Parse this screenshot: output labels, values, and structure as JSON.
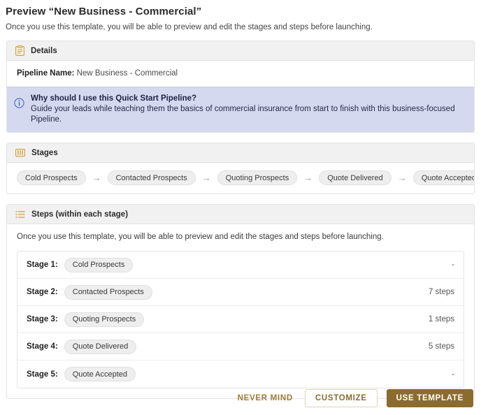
{
  "header": {
    "title": "Preview “New Business - Commercial”",
    "subtitle": "Once you use this template, you will be able to preview and edit the stages and steps before launching."
  },
  "details": {
    "section_title": "Details",
    "section_icon": "clipboard-icon",
    "pipeline_name_label": "Pipeline Name:",
    "pipeline_name_value": "New Business - Commercial",
    "callout": {
      "icon": "info-circle-icon",
      "title": "Why should I use this Quick Start Pipeline?",
      "text": "Guide your leads while teaching them the basics of commercial insurance from start to finish with this business-focused Pipeline.",
      "bg_color": "#d4d9ef"
    }
  },
  "stages": {
    "section_title": "Stages",
    "section_icon": "columns-icon",
    "arrow_glyph": "→",
    "items": [
      {
        "label": "Cold Prospects"
      },
      {
        "label": "Contacted Prospects"
      },
      {
        "label": "Quoting Prospects"
      },
      {
        "label": "Quote Delivered"
      },
      {
        "label": "Quote Accepted"
      }
    ]
  },
  "steps": {
    "section_title": "Steps (within each stage)",
    "section_icon": "list-icon",
    "intro": "Once you use this template, you will be able to preview and edit the stages and steps before launching.",
    "rows": [
      {
        "stage_label": "Stage 1:",
        "stage_name": "Cold Prospects",
        "count": "-"
      },
      {
        "stage_label": "Stage 2:",
        "stage_name": "Contacted Prospects",
        "count": "7 steps"
      },
      {
        "stage_label": "Stage 3:",
        "stage_name": "Quoting Prospects",
        "count": "1 steps"
      },
      {
        "stage_label": "Stage 4:",
        "stage_name": "Quote Delivered",
        "count": "5 steps"
      },
      {
        "stage_label": "Stage 5:",
        "stage_name": "Quote Accepted",
        "count": "-"
      }
    ]
  },
  "footer": {
    "never_mind_label": "NEVER MIND",
    "customize_label": "CUSTOMIZE",
    "use_template_label": "USE TEMPLATE",
    "accent_color": "#8b6b2e",
    "link_color": "#9d7b38"
  }
}
